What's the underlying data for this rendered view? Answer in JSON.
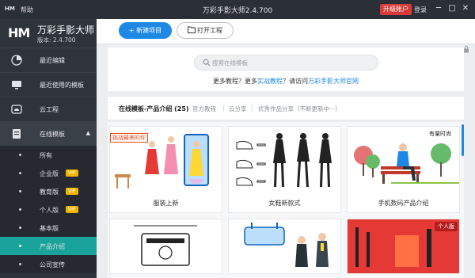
{
  "titlebar": {
    "logo_mini": "HM",
    "help": "帮助",
    "title": "万彩手影大师2.4.700",
    "upgrade": "升级账户",
    "login": "登录",
    "min": "─",
    "max": "□",
    "close": "✕"
  },
  "brand": {
    "mark": "HM",
    "name": "万彩手影大师",
    "version": "版本: 2.4.700"
  },
  "sidebar": {
    "items": [
      {
        "label": "最近编辑",
        "icon": "pie-chart-icon"
      },
      {
        "label": "最近使用的模板",
        "icon": "monitor-icon"
      },
      {
        "label": "云工程",
        "icon": "cloud-icon"
      },
      {
        "label": "在线模板",
        "icon": "template-icon",
        "caret": "▲"
      }
    ],
    "subitems": [
      {
        "label": "所有"
      },
      {
        "label": "企业版",
        "vip": "VIP"
      },
      {
        "label": "教育版",
        "vip": "VIP"
      },
      {
        "label": "个人版",
        "vip": "VIP"
      },
      {
        "label": "基本版"
      },
      {
        "label": "产品介绍"
      },
      {
        "label": "公司宣传"
      }
    ]
  },
  "toolbar": {
    "new_label": "+ 新建项目",
    "open_label": "打开工程"
  },
  "search": {
    "placeholder": "搜索在线模板"
  },
  "promo": {
    "part1": "更多教程？更多",
    "link1": "实战教程",
    "part2": "？请访问",
    "link2": "万彩手影大师官网"
  },
  "tabs": {
    "current": "在线模板-产品介绍 (25)",
    "t1": "官方教程",
    "t2": "云分享",
    "t3": "优秀作品分享（不断更新中···）",
    "sep": "|"
  },
  "cards": [
    {
      "caption": "服装上新",
      "badge": "挑战最美的你"
    },
    {
      "caption": "女鞋新款式"
    },
    {
      "caption": "手机数码产品介绍",
      "note": "有量时尚"
    },
    {
      "caption": ""
    },
    {
      "caption": ""
    },
    {
      "caption": "",
      "badge": "个人版"
    }
  ],
  "colors": {
    "accent": "#1e88e5",
    "sidebar_active": "#1aa39b",
    "upgrade": "#d93a3a",
    "vip": "#f0b400"
  }
}
